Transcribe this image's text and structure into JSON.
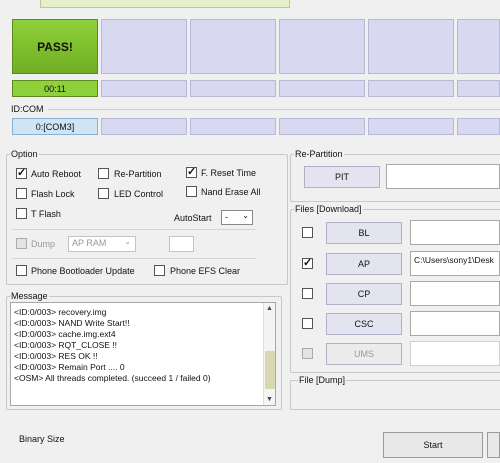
{
  "status": {
    "result_label": "PASS!",
    "elapsed_time": "00:11",
    "id_com_label": "ID:COM",
    "port_label": "0:[COM3]"
  },
  "option": {
    "title": "Option",
    "auto_reboot": "Auto Reboot",
    "re_partition": "Re-Partition",
    "f_reset_time": "F. Reset Time",
    "flash_lock": "Flash Lock",
    "led_control": "LED Control",
    "nand_erase_all": "Nand Erase All",
    "t_flash": "T Flash",
    "autostart_label": "AutoStart",
    "autostart_value": "-",
    "dump_label": "Dump",
    "dump_source": "AP RAM",
    "phone_bootloader_update": "Phone Bootloader Update",
    "phone_efs_clear": "Phone EFS Clear"
  },
  "message": {
    "title": "Message",
    "lines": [
      "<ID:0/003> recovery.img",
      "<ID:0/003> NAND Write Start!!",
      "<ID:0/003> cache.img.ext4",
      "<ID:0/003> RQT_CLOSE !!",
      "<ID:0/003> RES OK !!",
      "<ID:0/003> Remain Port .... 0",
      "<OSM> All threads completed. (succeed 1 / failed 0)"
    ]
  },
  "repartition": {
    "title": "Re-Partition",
    "pit_label": "PIT"
  },
  "files": {
    "title": "Files [Download]",
    "bl": "BL",
    "ap": "AP",
    "ap_path": "C:\\Users\\sony1\\Desk",
    "cp": "CP",
    "csc": "CSC",
    "ums": "UMS"
  },
  "dump": {
    "title": "File [Dump]"
  },
  "footer": {
    "binary_size_label": "Binary Size",
    "start_label": "Start"
  }
}
